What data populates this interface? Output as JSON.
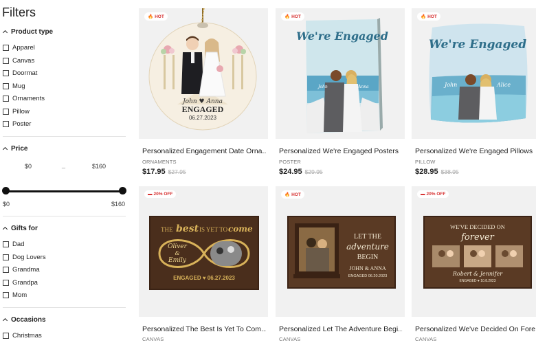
{
  "filters": {
    "title": "Filters",
    "product_type": {
      "label": "Product type",
      "options": [
        "Apparel",
        "Canvas",
        "Doormat",
        "Mug",
        "Ornaments",
        "Pillow",
        "Poster"
      ]
    },
    "price": {
      "label": "Price",
      "min_input": "$0",
      "separator": "_",
      "max_input": "$160",
      "min_label": "$0",
      "max_label": "$160"
    },
    "gifts_for": {
      "label": "Gifts for",
      "options": [
        "Dad",
        "Dog Lovers",
        "Grandma",
        "Grandpa",
        "Mom"
      ]
    },
    "occasions": {
      "label": "Occasions",
      "options": [
        "Christmas"
      ]
    }
  },
  "products": [
    {
      "badge": "HOT",
      "title": "Personalized Engagement Date Orna...",
      "category": "ORNAMENTS",
      "price": "$17.95",
      "old_price": "$27.95",
      "art": {
        "names": "John ♥ Anna",
        "headline": "ENGAGED",
        "date": "06.27.2023"
      }
    },
    {
      "badge": "HOT",
      "title": "Personalized We're Engaged Posters",
      "category": "POSTER",
      "price": "$24.95",
      "old_price": "$29.95",
      "art": {
        "headline": "We're Engaged",
        "name1": "John",
        "name2": "Anna"
      }
    },
    {
      "badge": "HOT",
      "title": "Personalized We're Engaged Pillows",
      "category": "PILLOW",
      "price": "$28.95",
      "old_price": "$38.95",
      "art": {
        "headline": "We're Engaged",
        "name1": "John",
        "name2": "Alice"
      }
    },
    {
      "badge": "20% OFF",
      "title": "Personalized The Best Is Yet To Com...",
      "category": "CANVAS",
      "art": {
        "line1a": "THE",
        "line1b": "best",
        "line1c": "IS YET TO",
        "line1d": "come",
        "name1": "Oliver",
        "amp": "&",
        "name2": "Emily",
        "footer": "ENGAGED ♥ 06.27.2023"
      }
    },
    {
      "badge": "HOT",
      "title": "Personalized Let The Adventure Begi...",
      "category": "CANVAS",
      "art": {
        "line1": "LET THE",
        "line2": "adventure",
        "line3": "BEGIN",
        "names": "JOHN & ANNA",
        "footer": "ENGAGED 06.20.2023"
      }
    },
    {
      "badge": "20% OFF",
      "title": "Personalized We've Decided On Fore...",
      "category": "CANVAS",
      "art": {
        "line1": "WE'VE DECIDED ON",
        "line2": "forever",
        "names": "Robert & Jennifer",
        "footer": "ENGAGED ♥ 10.8.2023"
      }
    }
  ],
  "colors": {
    "badge_red": "#d63030",
    "canvas_brown": "#4a2e1c",
    "gold": "#d8b25a"
  }
}
